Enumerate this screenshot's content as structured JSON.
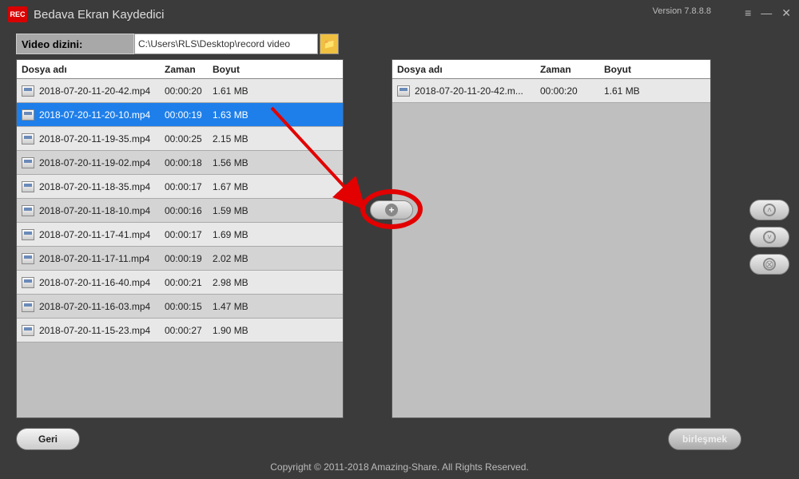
{
  "app": {
    "title": "Bedava Ekran Kaydedici",
    "rec": "REC",
    "version": "Version 7.8.8.8"
  },
  "path": {
    "label": "Video dizini:",
    "value": "C:\\Users\\RLS\\Desktop\\record video"
  },
  "columns": {
    "name": "Dosya adı",
    "time": "Zaman",
    "size": "Boyut"
  },
  "left_files": [
    {
      "name": "2018-07-20-11-20-42.mp4",
      "time": "00:00:20",
      "size": "1.61 MB",
      "selected": false
    },
    {
      "name": "2018-07-20-11-20-10.mp4",
      "time": "00:00:19",
      "size": "1.63 MB",
      "selected": true
    },
    {
      "name": "2018-07-20-11-19-35.mp4",
      "time": "00:00:25",
      "size": "2.15 MB",
      "selected": false
    },
    {
      "name": "2018-07-20-11-19-02.mp4",
      "time": "00:00:18",
      "size": "1.56 MB",
      "selected": false
    },
    {
      "name": "2018-07-20-11-18-35.mp4",
      "time": "00:00:17",
      "size": "1.67 MB",
      "selected": false
    },
    {
      "name": "2018-07-20-11-18-10.mp4",
      "time": "00:00:16",
      "size": "1.59 MB",
      "selected": false
    },
    {
      "name": "2018-07-20-11-17-41.mp4",
      "time": "00:00:17",
      "size": "1.69 MB",
      "selected": false
    },
    {
      "name": "2018-07-20-11-17-11.mp4",
      "time": "00:00:19",
      "size": "2.02 MB",
      "selected": false
    },
    {
      "name": "2018-07-20-11-16-40.mp4",
      "time": "00:00:21",
      "size": "2.98 MB",
      "selected": false
    },
    {
      "name": "2018-07-20-11-16-03.mp4",
      "time": "00:00:15",
      "size": "1.47 MB",
      "selected": false
    },
    {
      "name": "2018-07-20-11-15-23.mp4",
      "time": "00:00:27",
      "size": "1.90 MB",
      "selected": false
    }
  ],
  "right_files": [
    {
      "name": "2018-07-20-11-20-42.m...",
      "time": "00:00:20",
      "size": "1.61 MB"
    }
  ],
  "buttons": {
    "back": "Geri",
    "merge": "birleşmek"
  },
  "footer": {
    "copyright": "Copyright © 2011-2018 Amazing-Share. All Rights Reserved."
  }
}
